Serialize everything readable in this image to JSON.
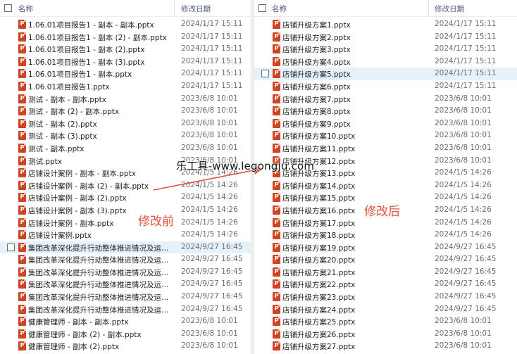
{
  "columns": {
    "name": "名称",
    "date": "修改日期"
  },
  "left_files": [
    {
      "name": "1.06.01项目报告1 - 副本 - 副本.pptx",
      "date": "2024/1/17 15:11"
    },
    {
      "name": "1.06.01项目报告1 - 副本 (2) - 副本.pptx",
      "date": "2024/1/17 15:11"
    },
    {
      "name": "1.06.01项目报告1 - 副本 (2).pptx",
      "date": "2024/1/17 15:11"
    },
    {
      "name": "1.06.01项目报告1 - 副本 (3).pptx",
      "date": "2024/1/17 15:11"
    },
    {
      "name": "1.06.01项目报告1 - 副本.pptx",
      "date": "2024/1/17 15:11"
    },
    {
      "name": "1.06.01项目报告1.pptx",
      "date": "2024/1/17 15:11"
    },
    {
      "name": "测试 - 副本 - 副本.pptx",
      "date": "2023/6/8 10:01"
    },
    {
      "name": "测试 - 副本 (2) - 副本.pptx",
      "date": "2023/6/8 10:01"
    },
    {
      "name": "测试 - 副本 (2).pptx",
      "date": "2023/6/8 10:01"
    },
    {
      "name": "测试 - 副本 (3).pptx",
      "date": "2023/6/8 10:01"
    },
    {
      "name": "测试 - 副本.pptx",
      "date": "2023/6/8 10:01"
    },
    {
      "name": "测试.pptx",
      "date": "2023/6/8 10:01"
    },
    {
      "name": "店铺设计案例 - 副本 - 副本.pptx",
      "date": "2024/1/5 14:26"
    },
    {
      "name": "店铺设计案例 - 副本 (2) - 副本.pptx",
      "date": "2024/1/5 14:26"
    },
    {
      "name": "店铺设计案例 - 副本 (2).pptx",
      "date": "2024/1/5 14:26"
    },
    {
      "name": "店铺设计案例 - 副本 (3).pptx",
      "date": "2024/1/5 14:26"
    },
    {
      "name": "店铺设计案例 - 副本.pptx",
      "date": "2024/1/5 14:26"
    },
    {
      "name": "店铺设计案例.pptx",
      "date": "2024/1/5 14:26"
    },
    {
      "name": "集团改革深化提升行动整体推进情况及运管...",
      "date": "2024/9/27 16:45"
    },
    {
      "name": "集团改革深化提升行动整体推进情况及运管...",
      "date": "2024/9/27 16:45"
    },
    {
      "name": "集团改革深化提升行动整体推进情况及运管...",
      "date": "2024/9/27 16:45"
    },
    {
      "name": "集团改革深化提升行动整体推进情况及运管...",
      "date": "2024/9/27 16:45"
    },
    {
      "name": "集团改革深化提升行动整体推进情况及运管...",
      "date": "2024/9/27 16:45"
    },
    {
      "name": "集团改革深化提升行动整体推进情况及运管...",
      "date": "2024/9/27 16:45"
    },
    {
      "name": "健康管理师 - 副本 - 副本.pptx",
      "date": "2023/6/8 10:01"
    },
    {
      "name": "健康管理师 - 副本 (2) - 副本.pptx",
      "date": "2023/6/8 10:01"
    },
    {
      "name": "健康管理师 - 副本 (2).pptx",
      "date": "2023/6/8 10:01"
    }
  ],
  "right_files": [
    {
      "name": "店铺升级方案1.pptx",
      "date": "2024/1/17 15:11"
    },
    {
      "name": "店铺升级方案2.pptx",
      "date": "2024/1/17 15:11"
    },
    {
      "name": "店铺升级方案3.pptx",
      "date": "2024/1/17 15:11"
    },
    {
      "name": "店铺升级方案4.pptx",
      "date": "2024/1/17 15:11"
    },
    {
      "name": "店铺升级方案5.pptx",
      "date": "2024/1/17 15:11"
    },
    {
      "name": "店铺升级方案6.pptx",
      "date": "2024/1/17 15:11"
    },
    {
      "name": "店铺升级方案7.pptx",
      "date": "2023/6/8 10:01"
    },
    {
      "name": "店铺升级方案8.pptx",
      "date": "2023/6/8 10:01"
    },
    {
      "name": "店铺升级方案9.pptx",
      "date": "2023/6/8 10:01"
    },
    {
      "name": "店铺升级方案10.pptx",
      "date": "2023/6/8 10:01"
    },
    {
      "name": "店铺升级方案11.pptx",
      "date": "2023/6/8 10:01"
    },
    {
      "name": "店铺升级方案12.pptx",
      "date": "2023/6/8 10:01"
    },
    {
      "name": "店铺升级方案13.pptx",
      "date": "2024/1/5 14:26"
    },
    {
      "name": "店铺升级方案14.pptx",
      "date": "2024/1/5 14:26"
    },
    {
      "name": "店铺升级方案15.pptx",
      "date": "2024/1/5 14:26"
    },
    {
      "name": "店铺升级方案16.pptx",
      "date": "2024/1/5 14:26"
    },
    {
      "name": "店铺升级方案17.pptx",
      "date": "2024/1/5 14:26"
    },
    {
      "name": "店铺升级方案18.pptx",
      "date": "2024/1/5 14:26"
    },
    {
      "name": "店铺升级方案19.pptx",
      "date": "2024/9/27 16:45"
    },
    {
      "name": "店铺升级方案20.pptx",
      "date": "2024/9/27 16:45"
    },
    {
      "name": "店铺升级方案21.pptx",
      "date": "2024/9/27 16:45"
    },
    {
      "name": "店铺升级方案22.pptx",
      "date": "2024/9/27 16:45"
    },
    {
      "name": "店铺升级方案23.pptx",
      "date": "2024/9/27 16:45"
    },
    {
      "name": "店铺升级方案24.pptx",
      "date": "2024/9/27 16:45"
    },
    {
      "name": "店铺升级方案25.pptx",
      "date": "2023/6/8 10:01"
    },
    {
      "name": "店铺升级方案26.pptx",
      "date": "2023/6/8 10:01"
    },
    {
      "name": "店铺升级方案27.pptx",
      "date": "2023/6/8 10:01"
    }
  ],
  "left_hover_index": 18,
  "right_hover_index": 4,
  "annotations": {
    "before": "修改前",
    "after": "修改后",
    "watermark": "乐工具-www.legongju.com"
  },
  "colors": {
    "accent": "#e0533a",
    "pptx_icon": "#d04423",
    "hover": "#e5f1fb"
  }
}
